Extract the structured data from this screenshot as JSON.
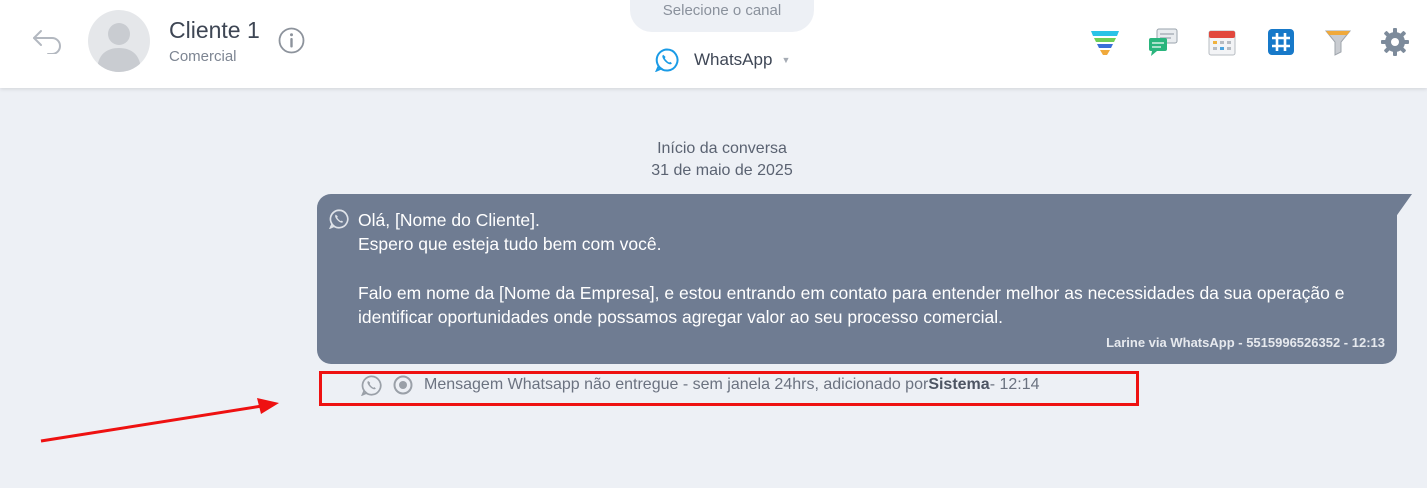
{
  "header": {
    "contact_name": "Cliente 1",
    "contact_subtitle": "Comercial",
    "channel_tab_label": "Selecione o canal",
    "channel_selected": "WhatsApp",
    "toolbar_icons": [
      "funnel-color-icon",
      "chat-bubbles-icon",
      "calendar-icon",
      "hashtag-icon",
      "filter-icon",
      "gear-icon"
    ]
  },
  "conversation": {
    "start_label": "Início da conversa",
    "start_date": "31 de maio de 2025",
    "message": {
      "text": "Olá, [Nome do Cliente].\nEspero que esteja tudo bem com você.\n\nFalo em nome da [Nome da Empresa], e estou entrando em contato para entender melhor as necessidades da sua operação e identificar oportunidades onde possamos agregar valor ao seu processo comercial.",
      "meta": "Larine via WhatsApp - 5515996526352 - 12:13"
    },
    "system_notice": {
      "prefix": "Mensagem Whatsapp não entregue - sem janela 24hrs, adicionado por ",
      "author": "Sistema",
      "suffix": " - 12:14"
    }
  },
  "colors": {
    "bubble": "#6f7c92",
    "background": "#edf0f5",
    "highlight": "#ee1111",
    "whatsapp_blue": "#1a9be6"
  }
}
